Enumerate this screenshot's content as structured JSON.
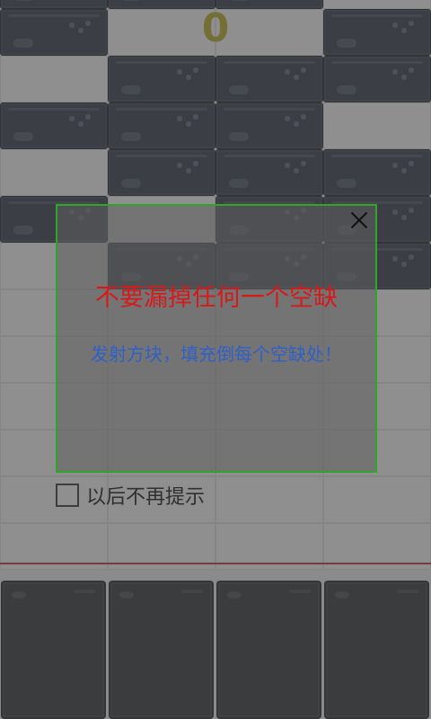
{
  "score": "0",
  "board": {
    "rows": [
      [
        1,
        1,
        1,
        0
      ],
      [
        1,
        0,
        0,
        1
      ],
      [
        0,
        1,
        1,
        1
      ],
      [
        1,
        1,
        1,
        0
      ],
      [
        0,
        1,
        1,
        1
      ],
      [
        1,
        0,
        1,
        1
      ],
      [
        0,
        1,
        1,
        1
      ],
      [
        0,
        0,
        0,
        0
      ],
      [
        0,
        0,
        0,
        0
      ],
      [
        0,
        0,
        0,
        0
      ],
      [
        0,
        0,
        0,
        0
      ],
      [
        0,
        0,
        0,
        0
      ],
      [
        0,
        0,
        0,
        0
      ]
    ],
    "shooter_count": 4
  },
  "dialog": {
    "title": "不要漏掉任何一个空缺",
    "subtitle": "发射方块，填充倒每个空缺处！",
    "close_icon": "close-icon"
  },
  "checkbox": {
    "label": "以后不再提示",
    "checked": false
  },
  "colors": {
    "score": "#a09418",
    "title": "#d61a1a",
    "subtitle": "#2f5fc8",
    "dialog_border": "#2fa52a",
    "deadline": "#a02828",
    "block": "#232b38",
    "empty": "#dcdcdc"
  }
}
